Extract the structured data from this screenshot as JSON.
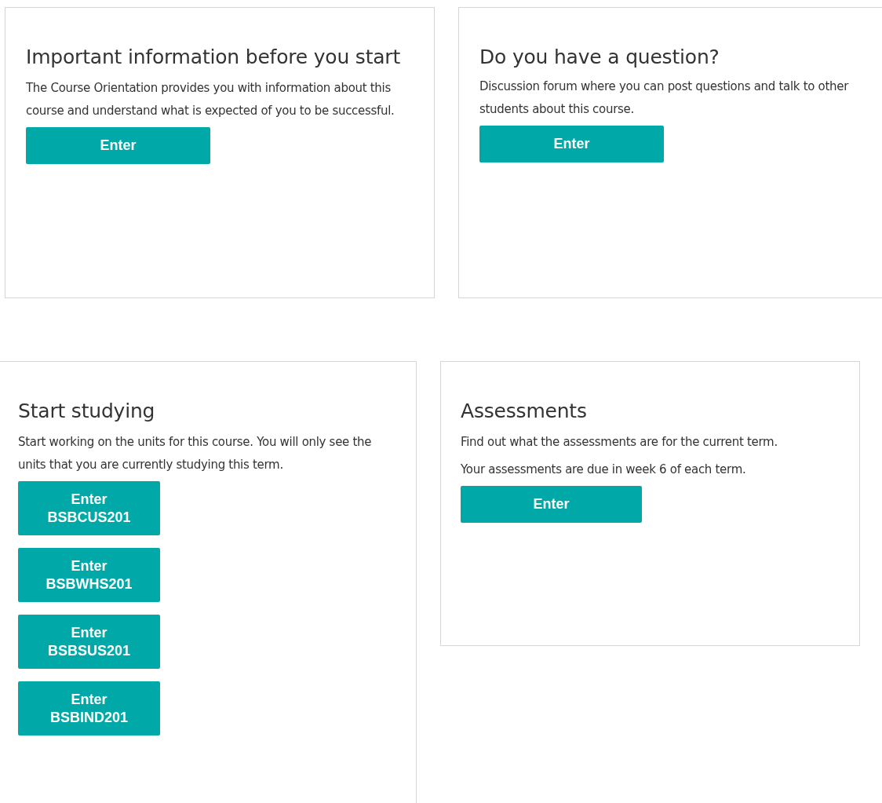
{
  "cards": [
    {
      "title": "Important information before you start",
      "paragraphs": [
        "The Course Orientation provides you with information about this course and understand what is expected of you to be successful."
      ],
      "buttons": [
        {
          "label": "Enter"
        }
      ]
    },
    {
      "title": "Do you have a question?",
      "paragraphs": [
        "Discussion forum where you can post questions and talk to other students about this course."
      ],
      "buttons": [
        {
          "label": "Enter"
        }
      ]
    },
    {
      "title": "Start studying",
      "paragraphs": [
        "Start working on the units for this course. You will only see the units that you are currently studying this term."
      ],
      "buttons": [
        {
          "label": "Enter",
          "code": "BSBCUS201"
        },
        {
          "label": "Enter",
          "code": "BSBWHS201"
        },
        {
          "label": "Enter",
          "code": "BSBSUS201"
        },
        {
          "label": "Enter",
          "code": "BSBIND201"
        }
      ]
    },
    {
      "title": "Assessments",
      "paragraphs": [
        "Find out what the assessments  are for the current term.",
        "Your assessments are due in week 6 of each term."
      ],
      "buttons": [
        {
          "label": "Enter"
        }
      ]
    }
  ]
}
